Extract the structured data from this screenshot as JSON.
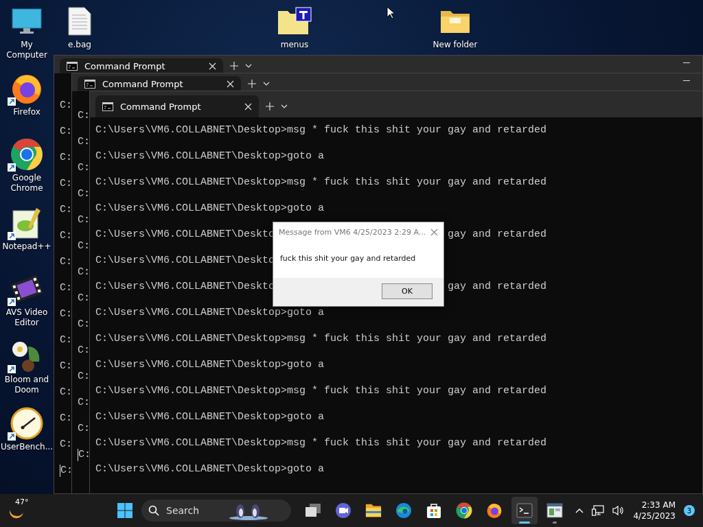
{
  "desktop": {
    "icons": [
      {
        "label": "My Computer",
        "kind": "computer",
        "shortcut": false
      },
      {
        "label": "e.bag",
        "kind": "document",
        "shortcut": false
      },
      {
        "label": "menus",
        "kind": "folder-badge",
        "shortcut": false
      },
      {
        "label": "New folder",
        "kind": "folder",
        "shortcut": false
      },
      {
        "label": "Firefox",
        "kind": "firefox",
        "shortcut": true
      },
      {
        "label": "Google Chrome",
        "kind": "chrome",
        "shortcut": true
      },
      {
        "label": "Notepad++",
        "kind": "notepad",
        "shortcut": true
      },
      {
        "label": "AVS Video Editor",
        "kind": "film",
        "shortcut": true
      },
      {
        "label": "Bloom and Doom",
        "kind": "flower",
        "shortcut": true
      },
      {
        "label": "UserBench...",
        "kind": "gauge",
        "shortcut": true
      }
    ]
  },
  "windows": [
    {
      "tab": {
        "title": "Command Prompt"
      },
      "lines": [
        {
          "text": "C:",
          "cursor": false
        },
        {
          "text": "C:",
          "cursor": false
        },
        {
          "text": "C:",
          "cursor": false
        },
        {
          "text": "C:",
          "cursor": false
        },
        {
          "text": "C:",
          "cursor": false
        },
        {
          "text": "C:",
          "cursor": false
        },
        {
          "text": "C:",
          "cursor": false
        },
        {
          "text": "C:",
          "cursor": false
        },
        {
          "text": "C:",
          "cursor": false
        },
        {
          "text": "C:",
          "cursor": false
        },
        {
          "text": "C:",
          "cursor": false
        },
        {
          "text": "C:",
          "cursor": false
        },
        {
          "text": "C:",
          "cursor": false
        },
        {
          "text": "C:",
          "cursor": false
        },
        {
          "text": "C:",
          "cursor": true
        }
      ]
    },
    {
      "tab": {
        "title": "Command Prompt"
      },
      "lines": [
        {
          "text": "C:",
          "cursor": false
        },
        {
          "text": "C:",
          "cursor": false
        },
        {
          "text": "C:",
          "cursor": false
        },
        {
          "text": "C:",
          "cursor": false
        },
        {
          "text": "C:",
          "cursor": false
        },
        {
          "text": "C:",
          "cursor": false
        },
        {
          "text": "C:",
          "cursor": false
        },
        {
          "text": "C:",
          "cursor": false
        },
        {
          "text": "C:",
          "cursor": false
        },
        {
          "text": "C:",
          "cursor": false
        },
        {
          "text": "C:",
          "cursor": false
        },
        {
          "text": "C:",
          "cursor": false
        },
        {
          "text": "C:",
          "cursor": false
        },
        {
          "text": "C:",
          "cursor": true
        }
      ]
    },
    {
      "tab": {
        "title": "Command Prompt"
      },
      "lines": [
        {
          "text": "C:\\Users\\VM6.COLLABNET\\Desktop>msg * fuck this shit your gay and retarded"
        },
        {
          "text": "C:\\Users\\VM6.COLLABNET\\Desktop>goto a"
        },
        {
          "text": "C:\\Users\\VM6.COLLABNET\\Desktop>msg * fuck this shit your gay and retarded"
        },
        {
          "text": "C:\\Users\\VM6.COLLABNET\\Desktop>goto a"
        },
        {
          "text": "C:\\Users\\VM6.COLLABNET\\Deskto",
          "tail": "gay and retarded"
        },
        {
          "text": "C:\\Users\\VM6.COLLABNET\\Deskto"
        },
        {
          "text": "C:\\Users\\VM6.COLLABNET\\Deskto",
          "tail": "gay and retarded"
        },
        {
          "text": "C:\\Users\\VM6.COLLABNET\\Desktop>goto a"
        },
        {
          "text": "C:\\Users\\VM6.COLLABNET\\Desktop>msg * fuck this shit your gay and retarded"
        },
        {
          "text": "C:\\Users\\VM6.COLLABNET\\Desktop>goto a"
        },
        {
          "text": "C:\\Users\\VM6.COLLABNET\\Desktop>msg * fuck this shit your gay and retarded"
        },
        {
          "text": "C:\\Users\\VM6.COLLABNET\\Desktop>goto a"
        },
        {
          "text": "C:\\Users\\VM6.COLLABNET\\Desktop>msg * fuck this shit your gay and retarded"
        },
        {
          "text": "C:\\Users\\VM6.COLLABNET\\Desktop>goto a"
        }
      ]
    }
  ],
  "dialog": {
    "title": "Message from VM6 4/25/2023 2:29 A...",
    "message": "fuck this shit your gay and retarded",
    "button": "OK"
  },
  "taskbar": {
    "weather": "47°",
    "search": {
      "placeholder": "Search"
    },
    "apps": [
      {
        "kind": "task-view",
        "running": false,
        "active": false
      },
      {
        "kind": "chat",
        "running": false,
        "active": false
      },
      {
        "kind": "explorer",
        "running": false,
        "active": false
      },
      {
        "kind": "edge",
        "running": false,
        "active": false
      },
      {
        "kind": "store",
        "running": false,
        "active": false
      },
      {
        "kind": "chrome",
        "running": false,
        "active": false
      },
      {
        "kind": "firefox",
        "running": false,
        "active": false
      },
      {
        "kind": "terminal",
        "running": true,
        "active": true
      },
      {
        "kind": "window-app",
        "running": true,
        "active": false
      }
    ],
    "time": "2:33 AM",
    "date": "4/25/2023",
    "notifications": "3"
  }
}
